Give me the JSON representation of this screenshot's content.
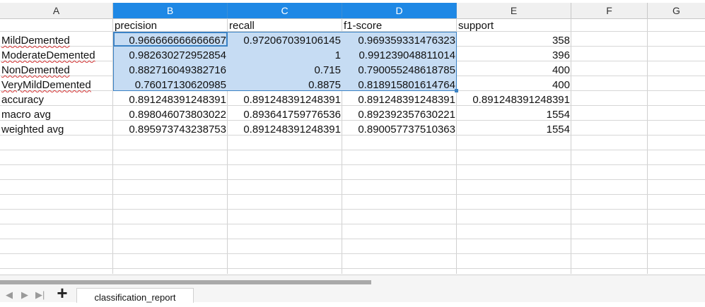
{
  "columns": [
    "A",
    "B",
    "C",
    "D",
    "E",
    "F",
    "G"
  ],
  "rows": [
    {
      "a": "",
      "b": "precision",
      "c": "recall",
      "d": "f1-score",
      "e": "support"
    },
    {
      "a": "MildDemented",
      "b": "0.966666666666667",
      "c": "0.972067039106145",
      "d": "0.969359331476323",
      "e": "358"
    },
    {
      "a": "ModerateDemented",
      "b": "0.982630272952854",
      "c": "1",
      "d": "0.991239048811014",
      "e": "396"
    },
    {
      "a": "NonDemented",
      "b": "0.882716049382716",
      "c": "0.715",
      "d": "0.790055248618785",
      "e": "400"
    },
    {
      "a": "VeryMildDemented",
      "b": "0.76017130620985",
      "c": "0.8875",
      "d": "0.818915801614764",
      "e": "400"
    },
    {
      "a": "accuracy",
      "b": "0.891248391248391",
      "c": "0.891248391248391",
      "d": "0.891248391248391",
      "e": "0.891248391248391"
    },
    {
      "a": "macro avg",
      "b": "0.898046073803022",
      "c": "0.893641759776536",
      "d": "0.892392357630221",
      "e": "1554"
    },
    {
      "a": "weighted avg",
      "b": "0.895973743238753",
      "c": "0.891248391248391",
      "d": "0.890057737510363",
      "e": "1554"
    }
  ],
  "sheet_tab": "classification_report",
  "add_sheet_symbol": "+",
  "nav": [
    "◀",
    "▶",
    "▶|"
  ],
  "colors": {
    "header_selected": "#1e88e5",
    "selection_fill": "#c6dcf3",
    "selection_border": "#3b82c4"
  }
}
